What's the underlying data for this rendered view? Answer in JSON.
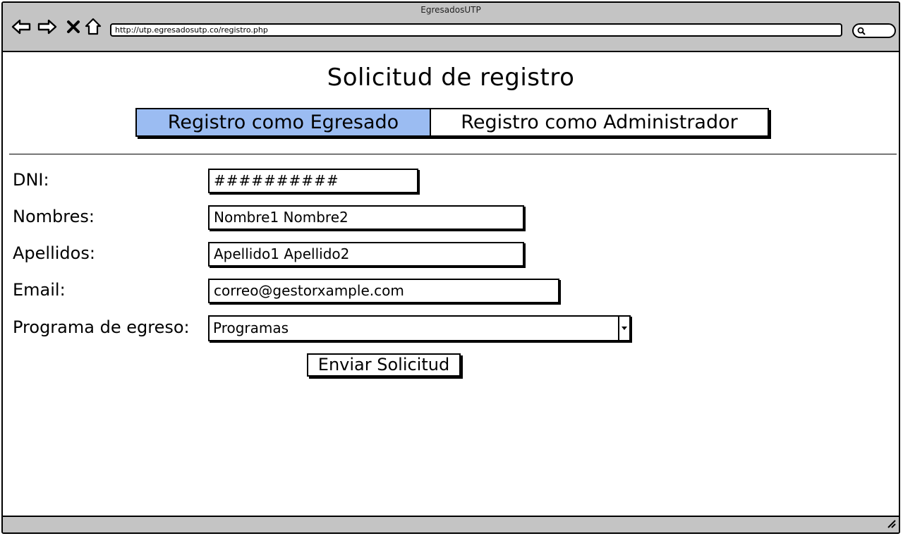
{
  "window": {
    "title": "EgresadosUTP",
    "url": "http://utp.egresadosutp.co/registro.php"
  },
  "toolbar": {
    "back_icon": "back-arrow-icon",
    "forward_icon": "forward-arrow-icon",
    "stop_icon": "close-icon",
    "home_icon": "home-icon",
    "search_icon": "search-icon"
  },
  "page": {
    "title": "Solicitud de registro"
  },
  "tabs": [
    {
      "label": "Registro como Egresado",
      "active": true
    },
    {
      "label": "Registro como Administrador",
      "active": false
    }
  ],
  "colors": {
    "active_tab": "#9bbcf2",
    "chrome": "#c4c4c4"
  },
  "form": {
    "dni": {
      "label": "DNI:",
      "value": "##########"
    },
    "nombres": {
      "label": "Nombres:",
      "value": "Nombre1 Nombre2"
    },
    "apellidos": {
      "label": "Apellidos:",
      "value": "Apellido1 Apellido2"
    },
    "email": {
      "label": "Email:",
      "value": "correo@gestorxample.com"
    },
    "programa": {
      "label": "Programa de egreso:",
      "value": "Programas"
    },
    "submit_label": "Enviar Solicitud"
  }
}
